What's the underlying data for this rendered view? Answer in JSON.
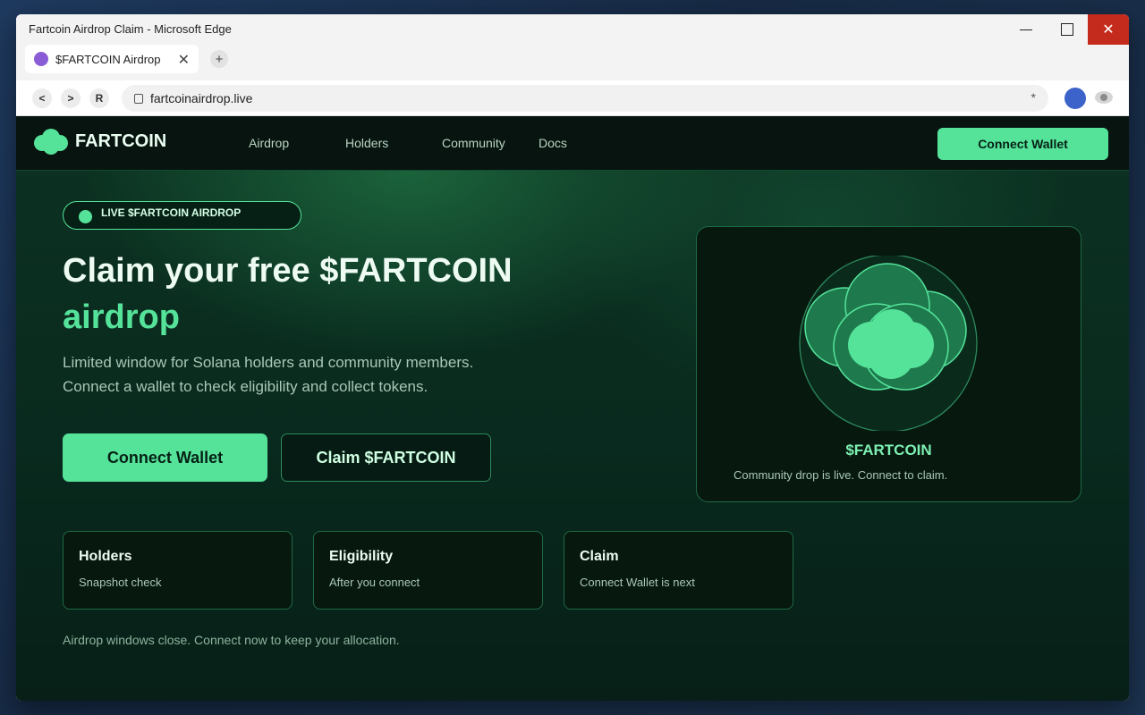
{
  "window": {
    "title": "Fartcoin Airdrop Claim - Microsoft Edge",
    "minimize_glyph": "",
    "maximize_glyph": "",
    "close_glyph": "✕"
  },
  "browser": {
    "tab_label": "$FARTCOIN Airdrop",
    "tab_close": "✕",
    "new_tab": "+",
    "back": "<",
    "forward": ">",
    "reload": "R",
    "url": "fartcoinairdrop.live",
    "star": "*"
  },
  "site": {
    "brand": "FARTCOIN",
    "nav": [
      "Airdrop",
      "Holders",
      "Community",
      "Docs"
    ],
    "header_cta": "Connect Wallet"
  },
  "hero": {
    "badge": "LIVE $FARTCOIN AIRDROP",
    "headline_line1": "Claim your free $FARTCOIN",
    "headline_line2": "airdrop",
    "subtext_line1": "Limited window for Solana holders and community members.",
    "subtext_line2": "Connect a wallet to check eligibility and collect tokens.",
    "primary_button": "Connect Wallet",
    "secondary_button": "Claim $FARTCOIN"
  },
  "coin_card": {
    "name": "$FARTCOIN",
    "description": "Community drop is live. Connect to claim."
  },
  "stats": [
    {
      "title": "Holders",
      "subtitle": "Snapshot check"
    },
    {
      "title": "Eligibility",
      "subtitle": "After you connect"
    },
    {
      "title": "Claim",
      "subtitle": "Connect Wallet is next"
    }
  ],
  "footer_note": "Airdrop windows close. Connect now to keep your allocation.",
  "colors": {
    "accent": "#55e39a",
    "header_bg": "#07140f",
    "page_bg": "#092a1e",
    "close_button": "#c42b1c"
  }
}
